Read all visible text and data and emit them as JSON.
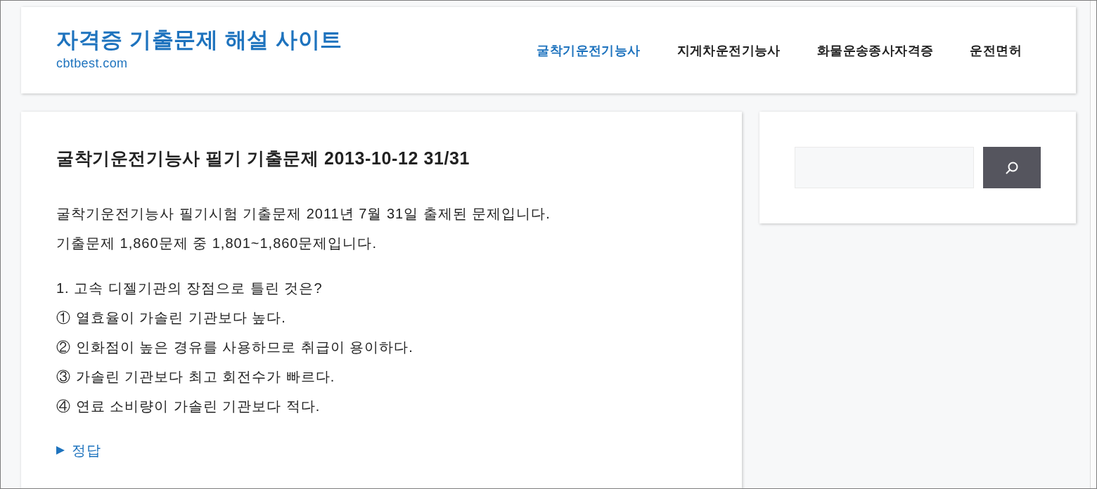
{
  "site": {
    "title": "자격증 기출문제 해설 사이트",
    "domain": "cbtbest.com"
  },
  "nav": [
    {
      "label": "굴착기운전기능사",
      "selected": true
    },
    {
      "label": "지게차운전기능사",
      "selected": false
    },
    {
      "label": "화물운송종사자격증",
      "selected": false
    },
    {
      "label": "운전면허",
      "selected": false
    }
  ],
  "post": {
    "title": "굴착기운전기능사 필기 기출문제 2013-10-12 31/31",
    "intro": [
      "굴착기운전기능사 필기시험 기출문제 2011년 7월 31일 출제된 문제입니다.",
      "기출문제 1,860문제 중 1,801~1,860문제입니다."
    ],
    "question": "1. 고속 디젤기관의 장점으로 틀린 것은?",
    "options": [
      "① 열효율이 가솔린 기관보다 높다.",
      "② 인화점이 높은 경유를 사용하므로 취급이 용이하다.",
      "③ 가솔린 기관보다 최고 회전수가 빠르다.",
      "④ 연료 소비량이 가솔린 기관보다 적다."
    ],
    "answer": {
      "label": "정답",
      "expanded": false
    }
  }
}
